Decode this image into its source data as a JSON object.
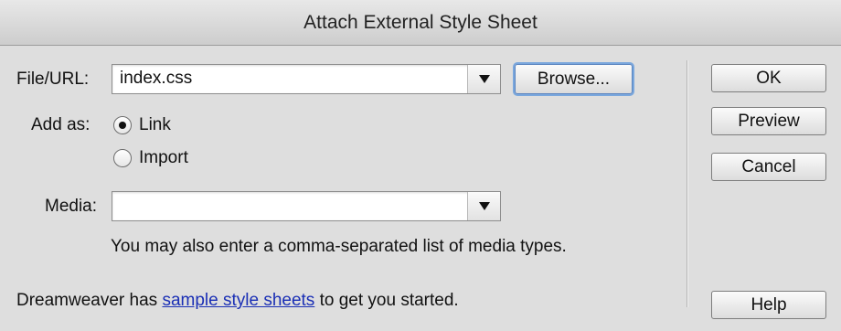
{
  "dialog": {
    "title": "Attach External Style Sheet"
  },
  "file_url": {
    "label": "File/URL:",
    "value": "index.css",
    "browse_label": "Browse..."
  },
  "add_as": {
    "label": "Add as:",
    "options": [
      {
        "label": "Link",
        "selected": true
      },
      {
        "label": "Import",
        "selected": false
      }
    ]
  },
  "media": {
    "label": "Media:",
    "value": "",
    "hint": "You may also enter a comma-separated list of media types."
  },
  "footer": {
    "prefix": "Dreamweaver has ",
    "link_text": "sample style sheets",
    "suffix": " to get you started."
  },
  "buttons": {
    "ok": "OK",
    "preview": "Preview",
    "cancel": "Cancel",
    "help": "Help"
  }
}
